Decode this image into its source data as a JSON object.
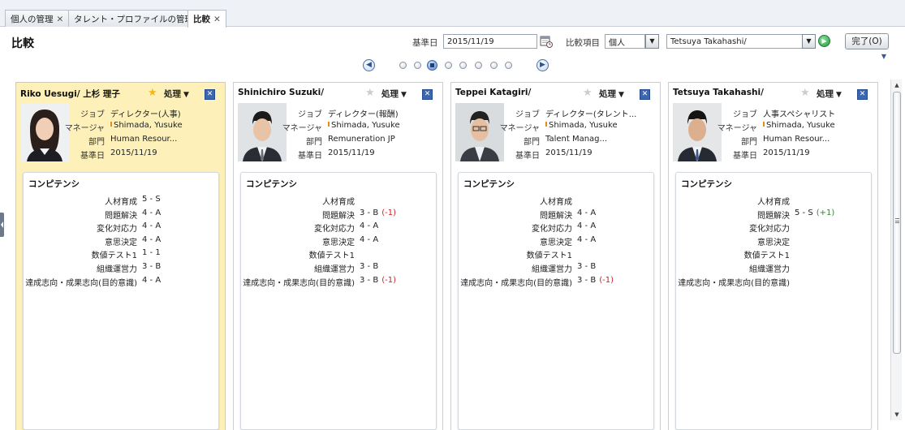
{
  "tabs": [
    {
      "label": "個人の管理",
      "close": "✕",
      "active": false
    },
    {
      "label": "タレント・プロファイルの管理",
      "close": "✕",
      "active": false
    },
    {
      "label": "比較",
      "close": "✕",
      "active": true
    }
  ],
  "header": {
    "title": "比較",
    "date_label": "基準日",
    "date_value": "2015/11/19",
    "compare_label": "比較項目",
    "compare_value": "個人",
    "person_value": "Tetsuya Takahashi/",
    "done_label": "完了(O)"
  },
  "pager": {
    "current_page": 3,
    "total_pages": 8
  },
  "icons": {
    "calendar": "calendar-icon",
    "dropdown": "chevron-down-icon",
    "go": "go-arrow-icon",
    "prev": "chevron-left-circle-icon",
    "next": "chevron-right-circle-icon",
    "star": "star-icon",
    "close": "close-icon"
  },
  "colors": {
    "selected_card_bg": "#fdf1b9",
    "negative_diff": "#cc2020",
    "positive_diff": "#2d8a2d",
    "accent_blue": "#3a66b4"
  },
  "info_labels": {
    "job": "ジョブ",
    "manager": "マネージャ",
    "department": "部門",
    "date": "基準日"
  },
  "competency_title": "コンピテンシ",
  "competency_labels": [
    "人材育成",
    "問題解決",
    "変化対応力",
    "意思決定",
    "数値テスト1",
    "組織運営力",
    "達成志向・成果志向(目的意識)"
  ],
  "people": [
    {
      "name": "Riko Uesugi/ 上杉 理子",
      "action": "処理",
      "selected": true,
      "starred": true,
      "job": "ディレクター(人事)",
      "manager": "Shimada, Yusuke",
      "department": "Human Resour...",
      "date": "2015/11/19",
      "competencies": [
        {
          "value": "5 - S",
          "diff": ""
        },
        {
          "value": "4 - A",
          "diff": ""
        },
        {
          "value": "4 - A",
          "diff": ""
        },
        {
          "value": "4 - A",
          "diff": ""
        },
        {
          "value": "1 - 1",
          "diff": ""
        },
        {
          "value": "3 - B",
          "diff": ""
        },
        {
          "value": "4 - A",
          "diff": ""
        }
      ]
    },
    {
      "name": "Shinichiro Suzuki/",
      "action": "処理",
      "selected": false,
      "starred": false,
      "job": "ディレクター(報酬)",
      "manager": "Shimada, Yusuke",
      "department": "Remuneration JP",
      "date": "2015/11/19",
      "competencies": [
        {
          "value": "",
          "diff": ""
        },
        {
          "value": "3 - B",
          "diff": "(-1)"
        },
        {
          "value": "4 - A",
          "diff": ""
        },
        {
          "value": "4 - A",
          "diff": ""
        },
        {
          "value": "",
          "diff": ""
        },
        {
          "value": "3 - B",
          "diff": ""
        },
        {
          "value": "3 - B",
          "diff": "(-1)"
        }
      ]
    },
    {
      "name": "Teppei Katagiri/",
      "action": "処理",
      "selected": false,
      "starred": false,
      "job": "ディレクター(タレント...",
      "manager": "Shimada, Yusuke",
      "department": "Talent Manag...",
      "date": "2015/11/19",
      "competencies": [
        {
          "value": "",
          "diff": ""
        },
        {
          "value": "4 - A",
          "diff": ""
        },
        {
          "value": "4 - A",
          "diff": ""
        },
        {
          "value": "4 - A",
          "diff": ""
        },
        {
          "value": "",
          "diff": ""
        },
        {
          "value": "3 - B",
          "diff": ""
        },
        {
          "value": "3 - B",
          "diff": "(-1)"
        }
      ]
    },
    {
      "name": "Tetsuya Takahashi/",
      "action": "処理",
      "selected": false,
      "starred": false,
      "job": "人事スペシャリスト",
      "manager": "Shimada, Yusuke",
      "department": "Human Resour...",
      "date": "2015/11/19",
      "competencies": [
        {
          "value": "",
          "diff": ""
        },
        {
          "value": "5 - S",
          "diff": "(+1)"
        },
        {
          "value": "",
          "diff": ""
        },
        {
          "value": "",
          "diff": ""
        },
        {
          "value": "",
          "diff": ""
        },
        {
          "value": "",
          "diff": ""
        },
        {
          "value": "",
          "diff": ""
        }
      ]
    }
  ]
}
